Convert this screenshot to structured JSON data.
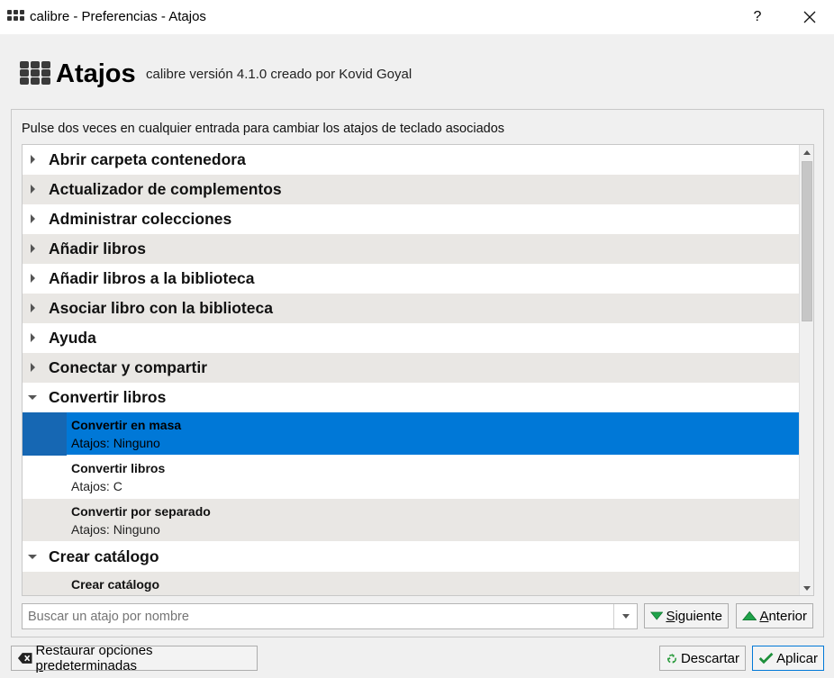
{
  "window": {
    "title": "calibre - Preferencias - Atajos",
    "help_label": "?",
    "icons": {
      "app": "calibre-grid-icon",
      "close": "close-icon"
    }
  },
  "header": {
    "title": "Atajos",
    "subtitle": "calibre versión 4.1.0 creado por Kovid Goyal"
  },
  "instructions": "Pulse dos veces en cualquier entrada para cambiar los atajos de teclado asociados",
  "tree": {
    "groups": [
      {
        "label": "Abrir carpeta contenedora",
        "expanded": false
      },
      {
        "label": "Actualizador de complementos",
        "expanded": false
      },
      {
        "label": "Administrar colecciones",
        "expanded": false
      },
      {
        "label": "Añadir libros",
        "expanded": false
      },
      {
        "label": "Añadir libros a la biblioteca",
        "expanded": false
      },
      {
        "label": "Asociar libro con la biblioteca",
        "expanded": false
      },
      {
        "label": "Ayuda",
        "expanded": false
      },
      {
        "label": "Conectar y compartir",
        "expanded": false
      },
      {
        "label": "Convertir libros",
        "expanded": true
      },
      {
        "label": "Crear catálogo",
        "expanded": true
      }
    ],
    "convert_children": [
      {
        "title": "Convertir en masa",
        "shortcut": "Atajos: Ninguno",
        "selected": true
      },
      {
        "title": "Convertir libros",
        "shortcut": "Atajos: C",
        "selected": false
      },
      {
        "title": "Convertir por separado",
        "shortcut": "Atajos: Ninguno",
        "selected": false
      }
    ],
    "catalog_children": [
      {
        "title": "Crear catálogo"
      }
    ]
  },
  "search": {
    "placeholder": "Buscar un atajo por nombre",
    "value": ""
  },
  "buttons": {
    "next": {
      "pre": "",
      "u": "S",
      "post": "iguiente"
    },
    "prev": {
      "pre": "",
      "u": "A",
      "post": "nterior"
    },
    "restore": {
      "pre": "Restaurar opciones ",
      "u": "p",
      "post": "redeterminadas"
    },
    "discard": "Descartar",
    "apply": "Aplicar"
  },
  "colors": {
    "selection": "#0078d7",
    "row_alt": "#e9e7e4",
    "green_arrow": "#1fa34a"
  }
}
